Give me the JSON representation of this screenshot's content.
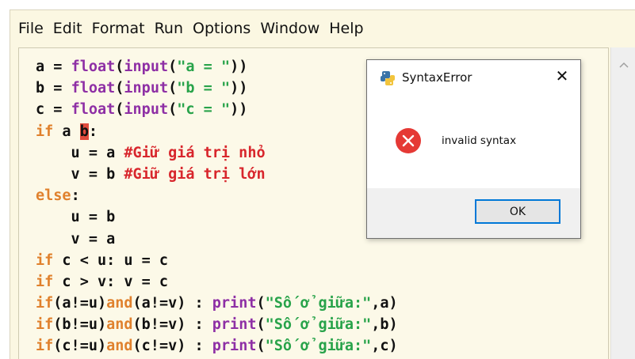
{
  "menubar": {
    "items": [
      "File",
      "Edit",
      "Format",
      "Run",
      "Options",
      "Window",
      "Help"
    ]
  },
  "editor": {
    "lines": [
      [
        {
          "t": "a = "
        },
        {
          "t": "float",
          "c": "bi"
        },
        {
          "t": "("
        },
        {
          "t": "input",
          "c": "bi"
        },
        {
          "t": "("
        },
        {
          "t": "\"a = \"",
          "c": "str"
        },
        {
          "t": "))"
        }
      ],
      [
        {
          "t": "b = "
        },
        {
          "t": "float",
          "c": "bi"
        },
        {
          "t": "("
        },
        {
          "t": "input",
          "c": "bi"
        },
        {
          "t": "("
        },
        {
          "t": "\"b = \"",
          "c": "str"
        },
        {
          "t": "))"
        }
      ],
      [
        {
          "t": "c = "
        },
        {
          "t": "float",
          "c": "bi"
        },
        {
          "t": "("
        },
        {
          "t": "input",
          "c": "bi"
        },
        {
          "t": "("
        },
        {
          "t": "\"c = \"",
          "c": "str"
        },
        {
          "t": "))"
        }
      ],
      [
        {
          "t": "if",
          "c": "kw"
        },
        {
          "t": " a "
        },
        {
          "t": "b",
          "c": "err"
        },
        {
          "t": ":"
        }
      ],
      [
        {
          "t": "    u = a "
        },
        {
          "t": "#Giữ giá trị nhỏ",
          "c": "cmt"
        }
      ],
      [
        {
          "t": "    v = b "
        },
        {
          "t": "#Giữ giá trị lớn",
          "c": "cmt"
        }
      ],
      [
        {
          "t": "else",
          "c": "kw"
        },
        {
          "t": ":"
        }
      ],
      [
        {
          "t": "    u = b"
        }
      ],
      [
        {
          "t": "    v = a"
        }
      ],
      [
        {
          "t": "if",
          "c": "kw"
        },
        {
          "t": " c < u: u = c"
        }
      ],
      [
        {
          "t": "if",
          "c": "kw"
        },
        {
          "t": " c > v: v = c"
        }
      ],
      [
        {
          "t": "if",
          "c": "kw"
        },
        {
          "t": "(a!=u)"
        },
        {
          "t": "and",
          "c": "kw"
        },
        {
          "t": "(a!=v) : "
        },
        {
          "t": "print",
          "c": "bi"
        },
        {
          "t": "("
        },
        {
          "t": "\"Số ở giữa:\"",
          "c": "str"
        },
        {
          "t": ",a)"
        }
      ],
      [
        {
          "t": "if",
          "c": "kw"
        },
        {
          "t": "(b!=u)"
        },
        {
          "t": "and",
          "c": "kw"
        },
        {
          "t": "(b!=v) : "
        },
        {
          "t": "print",
          "c": "bi"
        },
        {
          "t": "("
        },
        {
          "t": "\"Số ở giữa:\"",
          "c": "str"
        },
        {
          "t": ",b)"
        }
      ],
      [
        {
          "t": "if",
          "c": "kw"
        },
        {
          "t": "(c!=u)"
        },
        {
          "t": "and",
          "c": "kw"
        },
        {
          "t": "(c!=v) : "
        },
        {
          "t": "print",
          "c": "bi"
        },
        {
          "t": "("
        },
        {
          "t": "\"Số ở giữa:\"",
          "c": "str"
        },
        {
          "t": ",c)"
        }
      ]
    ]
  },
  "dialog": {
    "title": "SyntaxError",
    "close_label": "✕",
    "message": "invalid syntax",
    "ok_label": "OK"
  },
  "colors": {
    "keyword": "#e0812d",
    "builtin": "#8e2fa5",
    "string": "#28a34a",
    "comment": "#d8262c",
    "error_highlight": "#e14b3d",
    "editor_bg": "#fcf9e8",
    "button_focus": "#0078d7"
  },
  "icons": {
    "dialog_app": "python-icon",
    "dialog_error": "error-icon",
    "scroll": "chevron-up-icon"
  }
}
